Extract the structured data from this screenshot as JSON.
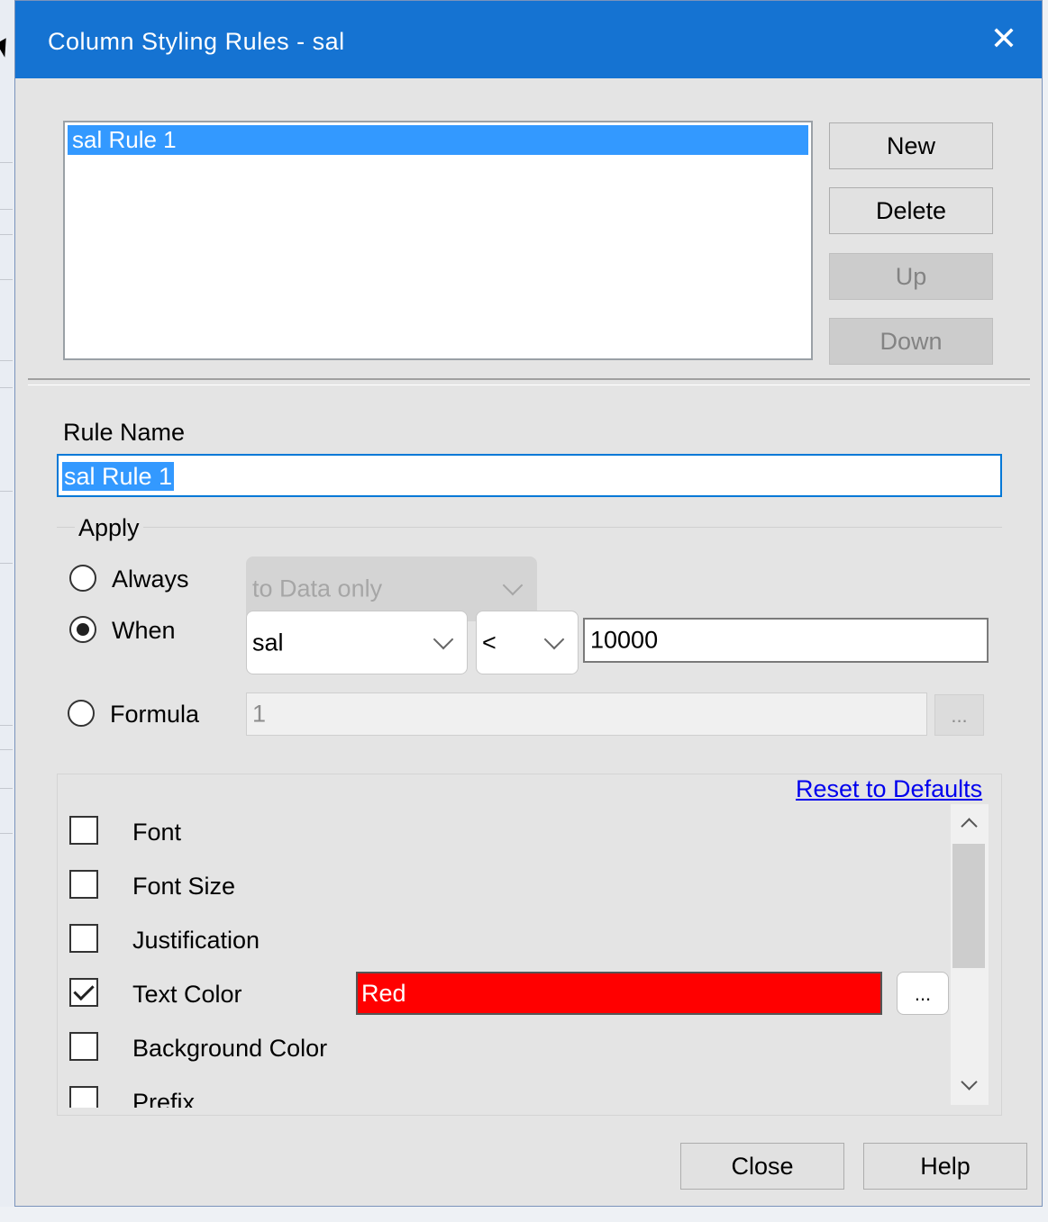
{
  "window": {
    "title": "Column Styling Rules - sal",
    "close_glyph": "✕"
  },
  "rules_list": {
    "items": [
      "sal Rule 1"
    ],
    "selected_index": 0
  },
  "side_buttons": {
    "new": "New",
    "delete": "Delete",
    "up": "Up",
    "down": "Down"
  },
  "rule_name": {
    "label": "Rule Name",
    "value": "sal Rule 1"
  },
  "apply": {
    "label": "Apply",
    "always_label": "Always",
    "when_label": "When",
    "formula_label": "Formula",
    "selected": "When",
    "scope_combo": "to Data only",
    "column_combo": "sal",
    "operator_combo": "<",
    "value": "10000",
    "formula_value": "1",
    "formula_button": "..."
  },
  "style_options": {
    "reset_link": "Reset to Defaults",
    "items": [
      {
        "label": "Font",
        "checked": false
      },
      {
        "label": "Font Size",
        "checked": false
      },
      {
        "label": "Justification",
        "checked": false
      },
      {
        "label": "Text Color",
        "checked": true,
        "value": "Red",
        "color": "#ff0000"
      },
      {
        "label": "Background Color",
        "checked": false
      },
      {
        "label": "Prefix",
        "checked": false
      }
    ],
    "color_button": "..."
  },
  "footer": {
    "close": "Close",
    "help": "Help"
  },
  "colors": {
    "titlebar": "#1573d2",
    "selection": "#3399ff",
    "link": "#0000ee"
  }
}
